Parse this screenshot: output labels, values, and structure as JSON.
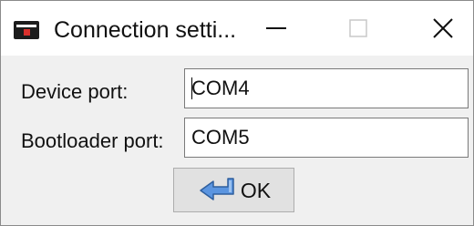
{
  "window": {
    "title": "Connection setti...",
    "controls": {
      "minimize": "minimize-icon",
      "maximize": "maximize-icon",
      "close": "close-icon"
    }
  },
  "form": {
    "device_port": {
      "label": "Device port:",
      "value": "COM4"
    },
    "bootloader_port": {
      "label": "Bootloader port:",
      "value": "COM5"
    }
  },
  "ok_button": {
    "label": "OK",
    "icon": "enter-arrow-icon"
  },
  "colors": {
    "titlebar": "#ffffff",
    "client_area": "#f0f0f0",
    "button_face": "#e1e1e1",
    "icon_blue": "#4a86d8"
  }
}
